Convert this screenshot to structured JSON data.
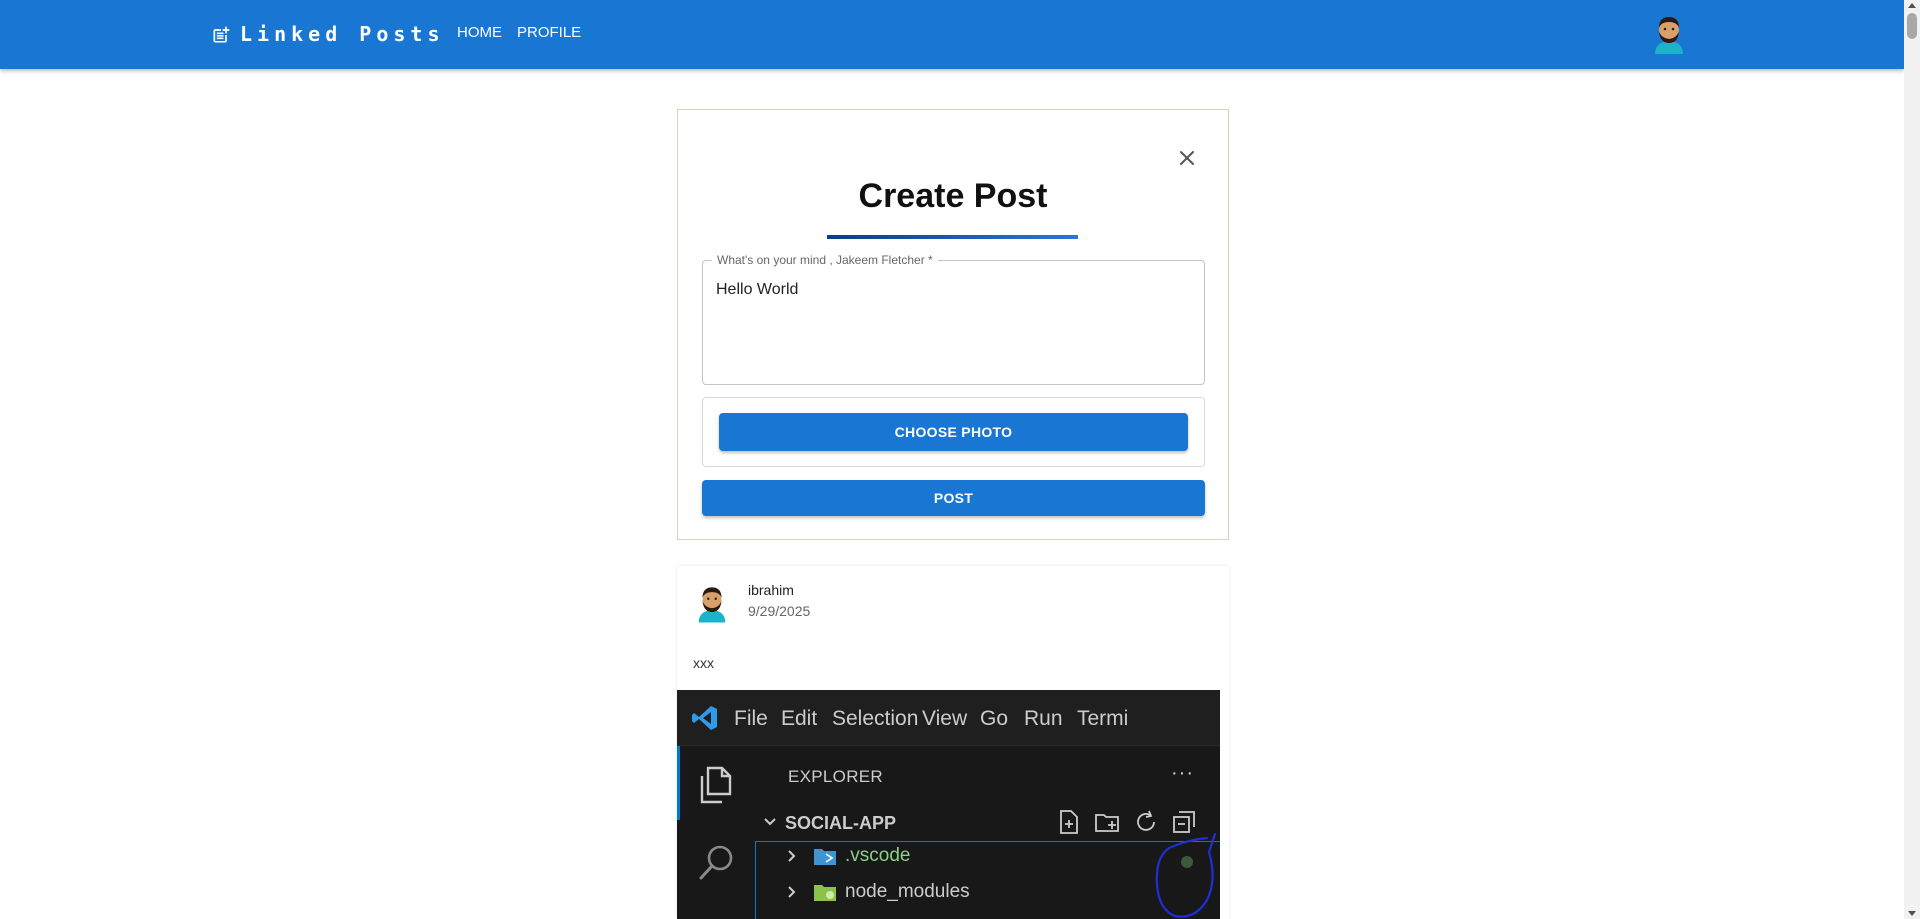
{
  "appbar": {
    "brand": "Linked Posts",
    "nav": {
      "home": "HOME",
      "profile": "PROFILE"
    },
    "brand_icon": "post-add-icon",
    "avatar": "user-avatar"
  },
  "create_post": {
    "title": "Create Post",
    "close_icon": "close-icon",
    "field_label": "What's on your mind , Jakeem Fletcher *",
    "field_value": "Hello World",
    "choose_photo_label": "CHOOSE PHOTO",
    "post_label": "POST"
  },
  "feed": {
    "posts": [
      {
        "author": "ibrahim",
        "date": "9/29/2025",
        "body": "xxx",
        "image": {
          "menu": [
            "File",
            "Edit",
            "Selection",
            "View",
            "Go",
            "Run",
            "Termi"
          ],
          "explorer_title": "EXPLORER",
          "more": "···",
          "folder": "SOCIAL-APP",
          "items": [
            {
              "name": ".vscode",
              "color": "#89d185"
            },
            {
              "name": "node_modules",
              "color": "#cccccc"
            }
          ]
        }
      }
    ]
  },
  "colors": {
    "primary": "#1976d2",
    "title_underline_start": "#0d3b8c",
    "title_underline_end": "#2f74d8",
    "card_border": "#d9d3bc"
  }
}
